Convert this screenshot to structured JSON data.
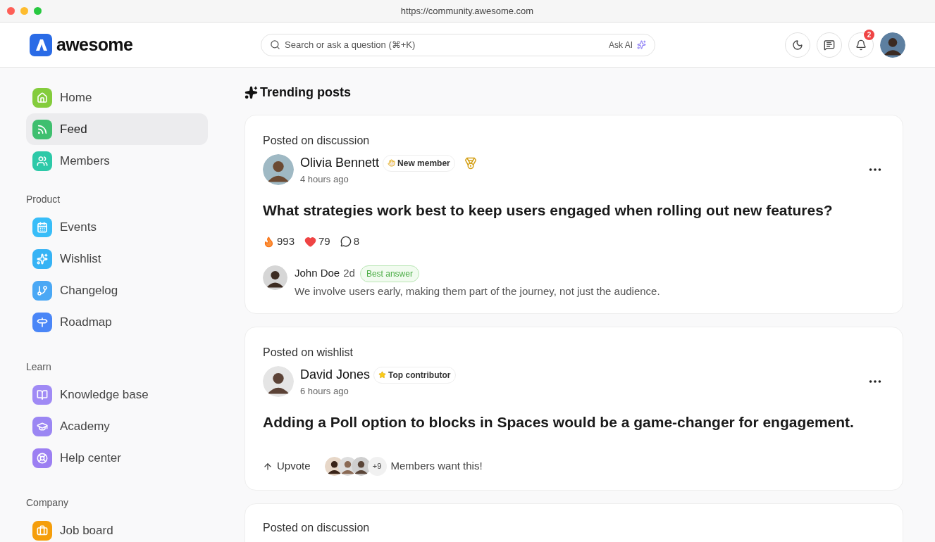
{
  "browser": {
    "url": "https://community.awesome.com"
  },
  "header": {
    "logo": "awesome",
    "search": {
      "placeholder": "Search or ask a question (⌘+K)",
      "ask_ai": "Ask AI"
    },
    "notifications": "2"
  },
  "sidebar": {
    "sections": [
      {
        "items": [
          {
            "label": "Home",
            "kind": "home",
            "color": "#84cc3c",
            "selected": false
          },
          {
            "label": "Feed",
            "kind": "feed",
            "color": "#3fbf6f",
            "selected": true
          },
          {
            "label": "Members",
            "kind": "members",
            "color": "#2dc9a8",
            "selected": false
          }
        ]
      },
      {
        "heading": "Product",
        "items": [
          {
            "label": "Events",
            "kind": "events",
            "color": "#38bdf8",
            "selected": false
          },
          {
            "label": "Wishlist",
            "kind": "wishlist",
            "color": "#36b3f5",
            "selected": false
          },
          {
            "label": "Changelog",
            "kind": "changelog",
            "color": "#4aa8f5",
            "selected": false
          },
          {
            "label": "Roadmap",
            "kind": "roadmap",
            "color": "#4a86f7",
            "selected": false
          }
        ]
      },
      {
        "heading": "Learn",
        "items": [
          {
            "label": "Knowledge base",
            "kind": "book",
            "color": "#a08af5",
            "selected": false
          },
          {
            "label": "Academy",
            "kind": "academy",
            "color": "#9b86f3",
            "selected": false
          },
          {
            "label": "Help center",
            "kind": "help",
            "color": "#9c7ff2",
            "selected": false
          }
        ]
      },
      {
        "heading": "Company",
        "items": [
          {
            "label": "Job board",
            "kind": "jobs",
            "color": "#f59e0b",
            "selected": false
          }
        ]
      }
    ]
  },
  "feed": {
    "title": "Trending posts",
    "posts": [
      {
        "kind": "discussion",
        "posted_on": "Posted on discussion",
        "author": "Olivia Bennett",
        "badge": {
          "kind": "wave",
          "label": "New member"
        },
        "medal": true,
        "time": "4 hours ago",
        "title": "What strategies work best to keep users engaged when rolling out new features?",
        "reactions": {
          "fire": "993",
          "hearts": "79",
          "comments": "8"
        },
        "answer": {
          "author": "John Doe",
          "time": "2d",
          "tag": "Best answer",
          "text": "We involve users early, making them part of the journey, not just the audience."
        }
      },
      {
        "kind": "wishlist",
        "posted_on": "Posted on wishlist",
        "author": "David Jones",
        "badge": {
          "kind": "star",
          "label": "Top contributor"
        },
        "time": "6 hours ago",
        "title": "Adding a Poll option to blocks in Spaces would be a game-changer for engagement.",
        "upvote": "Upvote",
        "extra_count": "+9",
        "voters_label": "Members want this!"
      },
      {
        "kind": "partial",
        "posted_on": "Posted on discussion"
      }
    ]
  }
}
